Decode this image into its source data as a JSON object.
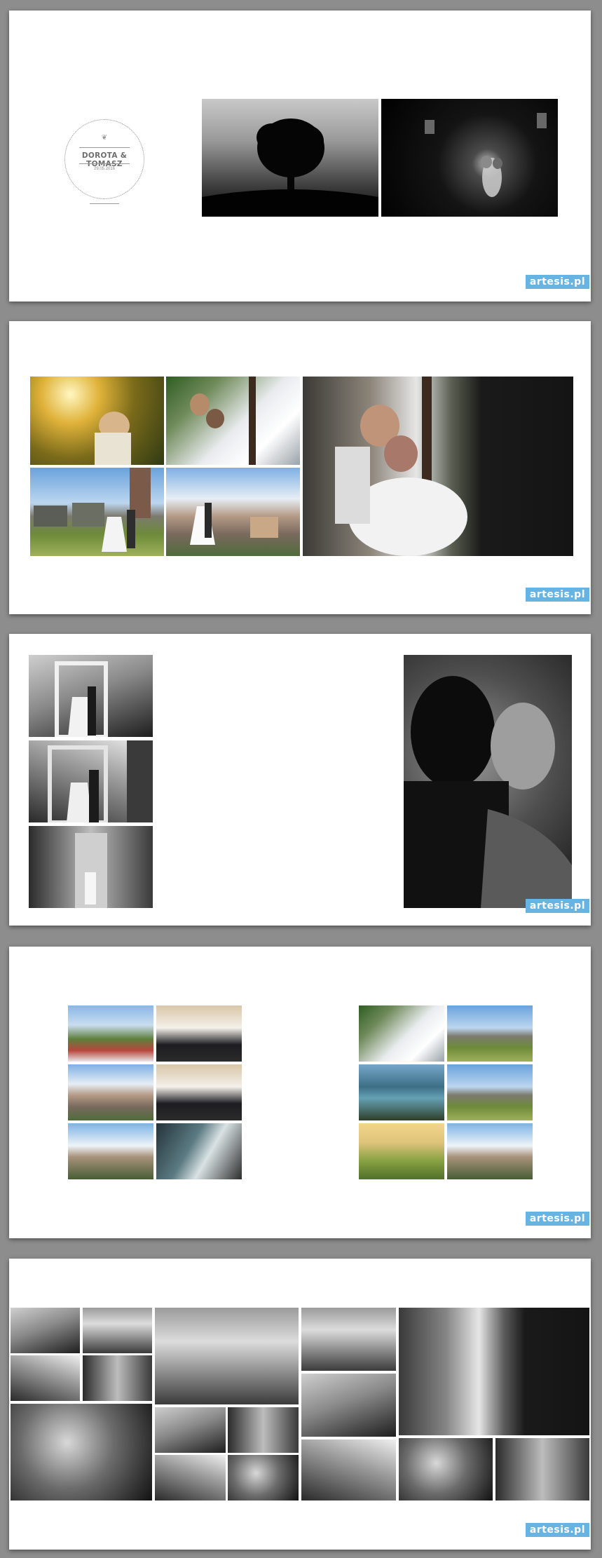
{
  "watermark": "artesis.pl",
  "cover": {
    "names": "DOROTA & TOMASZ",
    "date": "29.05.2016"
  },
  "spreads": [
    {
      "name": "spread-1",
      "photos": [
        "tree-silhouette-photo",
        "couple-night-lanterns-photo"
      ]
    },
    {
      "name": "spread-2",
      "photos": [
        "sunlit-embrace-photo",
        "window-dress-photo",
        "old-trucks-field-photo",
        "rooftop-city-photo",
        "window-kiss-large-photo"
      ]
    },
    {
      "name": "spread-3",
      "photos": [
        "doorway-bw-1-photo",
        "doorway-bw-2-photo",
        "doorway-bw-3-photo",
        "silhouette-kiss-bw-photo"
      ]
    },
    {
      "name": "spread-4",
      "photos": [
        "left-grid-photos",
        "right-grid-photos"
      ]
    },
    {
      "name": "spread-5",
      "photos": [
        "bw-collage-photos"
      ]
    }
  ],
  "colors": {
    "background": "#8d8d8d",
    "page": "#ffffff",
    "watermark": "#67b3e2"
  }
}
